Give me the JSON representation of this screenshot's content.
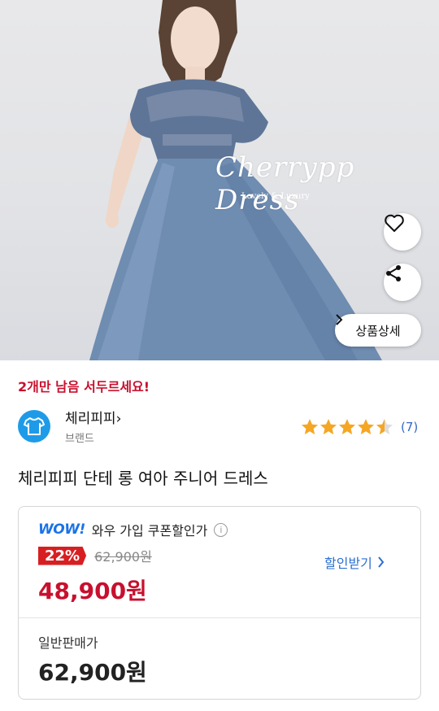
{
  "product_image": {
    "watermark": "Cherrypp Dress",
    "watermark_sub": "Lovely & Luxury",
    "wishlist_icon": "heart-outline-icon",
    "share_icon": "share-icon",
    "detail_button_label": "상품상세",
    "detail_button_icon": "chevron-right-icon"
  },
  "stock_notice": "2개만 남음 서두르세요!",
  "brand": {
    "name": "체리피피",
    "chevron": "›",
    "sub_label": "브랜드",
    "logo_icon": "tshirt-icon",
    "logo_color": "#1e9be8"
  },
  "rating": {
    "stars": 4.5,
    "max": 5,
    "count_text": "(7)",
    "star_color": "#f5a623"
  },
  "product_title": "체리피피 단테 롱 여아 주니어 드레스",
  "price": {
    "wow_logo": "WOW!",
    "wow_label": "와우 가입 쿠폰할인가",
    "info_icon": "info-icon",
    "discount_percent": "22%",
    "original_price": "62,900원",
    "sale_price": "48,900원",
    "coupon_link": "할인받기",
    "normal_label": "일반판매가",
    "normal_price": "62,900원",
    "accent_red": "#c8102e",
    "link_blue": "#2b6fd1"
  }
}
